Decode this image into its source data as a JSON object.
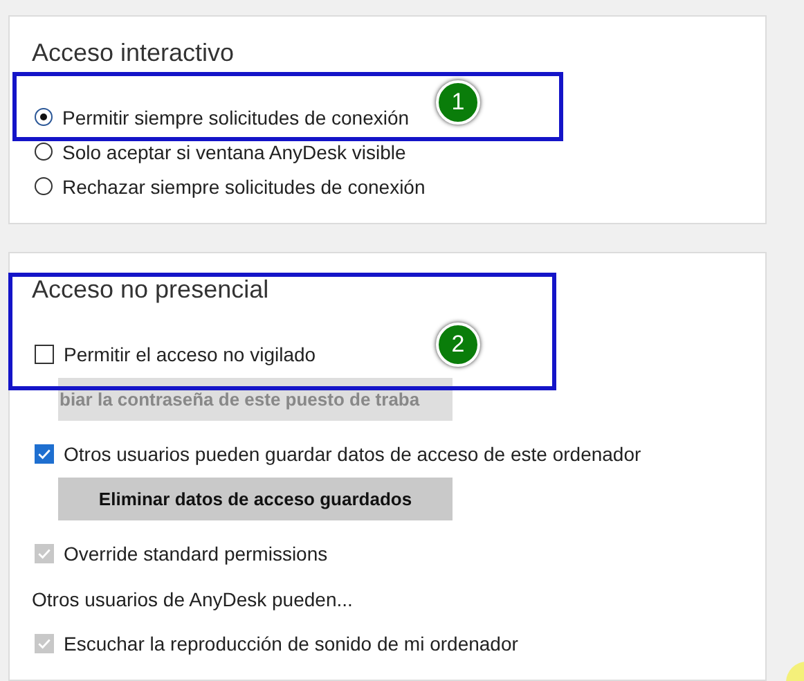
{
  "sections": [
    {
      "title": "Acceso interactivo",
      "items": [
        {
          "kind": "radio",
          "label": "Permitir siempre solicitudes de conexión",
          "selected": true
        },
        {
          "kind": "radio",
          "label": "Solo aceptar si ventana AnyDesk visible",
          "selected": false
        },
        {
          "kind": "radio",
          "label": "Rechazar siempre solicitudes de conexión",
          "selected": false
        }
      ]
    },
    {
      "title": "Acceso no presencial",
      "items": [
        {
          "kind": "checkbox",
          "label": "Permitir el acceso no vigilado",
          "checked": false,
          "disabled": false
        },
        {
          "kind": "button",
          "label": "biar la contraseña de este puesto de traba",
          "disabled": true
        },
        {
          "kind": "checkbox",
          "label": "Otros usuarios pueden guardar datos de acceso de este ordenador",
          "checked": true,
          "disabled": false
        },
        {
          "kind": "button",
          "label": "Eliminar datos de acceso guardados",
          "disabled": false
        },
        {
          "kind": "checkbox",
          "label": "Override standard permissions",
          "checked": true,
          "disabled": true
        },
        {
          "kind": "text",
          "label": "Otros usuarios de AnyDesk pueden..."
        },
        {
          "kind": "checkbox",
          "label": "Escuchar la reproducción de sonido de mi ordenador",
          "checked": true,
          "disabled": true
        }
      ]
    }
  ],
  "annotations": [
    {
      "label": "1"
    },
    {
      "label": "2"
    }
  ]
}
